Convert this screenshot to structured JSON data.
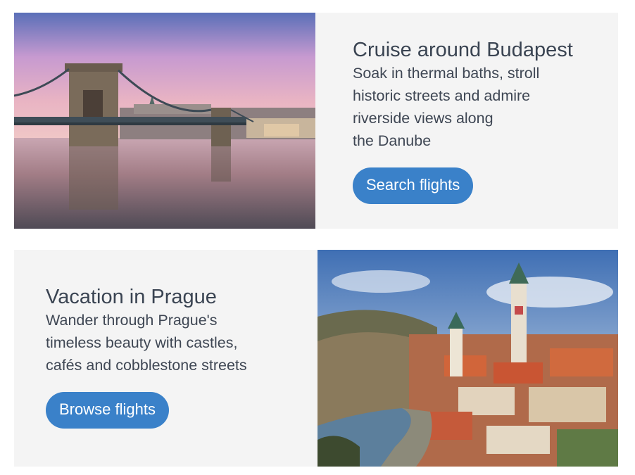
{
  "cards": [
    {
      "title": "Cruise around Budapest",
      "description_lines": [
        "Soak in thermal baths, stroll",
        "historic streets and admire",
        "riverside views along",
        "the Danube"
      ],
      "button_label": "Search flights"
    },
    {
      "title": "Vacation in Prague",
      "description_lines": [
        "Wander through Prague's",
        "timeless beauty with castles,",
        "cafés and cobblestone streets"
      ],
      "button_label": "Browse flights"
    }
  ],
  "colors": {
    "card_bg": "#f4f4f4",
    "button_bg": "#3a81c9",
    "button_text": "#ffffff",
    "title_text": "#3a4452"
  }
}
